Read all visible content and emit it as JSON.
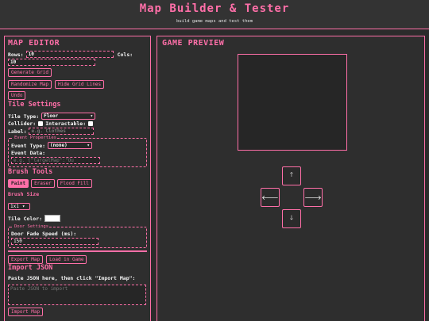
{
  "header": {
    "title": "Map Builder & Tester",
    "subtitle": "build game maps and test them"
  },
  "editor": {
    "title": "MAP EDITOR",
    "rows_label": "Rows:",
    "rows_value": "10",
    "cols_label": "Cols:",
    "cols_value": "10",
    "generate_label": "Generate Grid",
    "randomize_label": "Randomize Map",
    "hide_grid_label": "Hide Grid Lines",
    "undo_label": "Undo",
    "tile_settings": {
      "title": "Tile Settings",
      "type_label": "Tile Type:",
      "type_value": "Floor",
      "collider_label": "Collider:",
      "interactable_label": "Interactable:",
      "label_label": "Label:",
      "label_placeholder": "e.g. Clothes",
      "event_legend": "Event Properties",
      "event_type_label": "Event Type:",
      "event_type_value": "(none)",
      "event_data_label": "Event Data:",
      "event_data_placeholder": "e.g. {\"targetMap\":\"Ou"
    },
    "brush": {
      "title": "Brush Tools",
      "paint_label": "Paint",
      "eraser_label": "Eraser",
      "fill_label": "Flood Fill",
      "size_label": "Brush Size",
      "size_value": "1x1",
      "tile_color_label": "Tile Color:",
      "tile_color": "#ffffff"
    },
    "door": {
      "legend": "Door Settings",
      "speed_label": "Door Fade Speed (ms):",
      "speed_value": "150"
    },
    "export_label": "Export Map",
    "load_label": "Load in Game",
    "import": {
      "title": "Import JSON",
      "instructions": "Paste JSON here, then click \"Import Map\":",
      "placeholder": "Paste JSON to import",
      "button_label": "Import Map"
    }
  },
  "preview": {
    "title": "GAME PREVIEW",
    "up_glyph": "🡑",
    "left_glyph": "🡐",
    "right_glyph": "🡒",
    "down_glyph": "🡓"
  },
  "colors": {
    "accent": "#ff6fa8",
    "background": "#2b2b2b"
  }
}
